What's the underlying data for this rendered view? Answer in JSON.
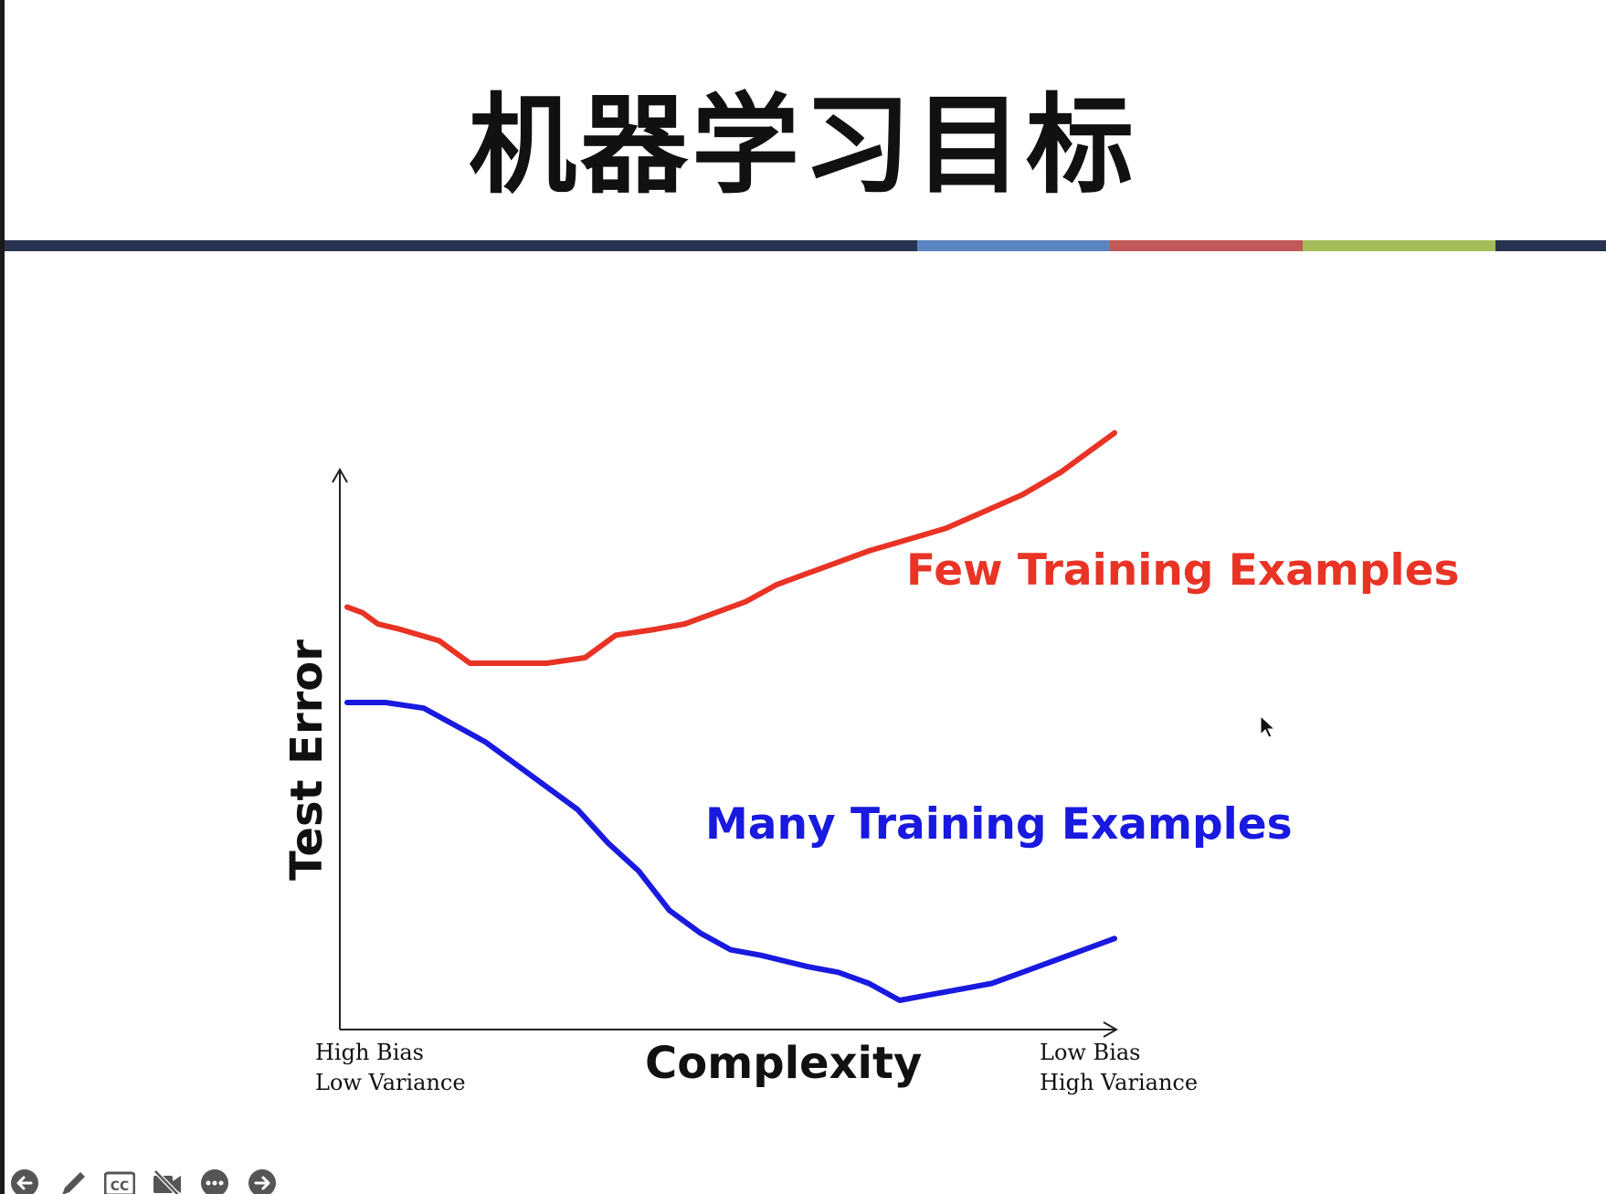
{
  "slide": {
    "title": "机器学习目标",
    "bar_colors": [
      "#28344f",
      "#5b85c0",
      "#bf5a58",
      "#a6be5a",
      "#28344f"
    ]
  },
  "chart_data": {
    "type": "line",
    "xlabel": "Complexity",
    "ylabel": "Test Error",
    "x_tick_labels": {
      "left": [
        "High Bias",
        "Low Variance"
      ],
      "right": [
        "Low Bias",
        "High Variance"
      ]
    },
    "xlim": [
      0,
      100
    ],
    "ylim": [
      0,
      100
    ],
    "series": [
      {
        "name": "Few Training Examples",
        "color": "#e83325",
        "x": [
          0,
          2,
          4,
          7,
          12,
          16,
          21,
          26,
          31,
          35,
          40,
          44,
          48,
          52,
          56,
          60,
          64,
          68,
          73,
          78,
          83,
          88,
          93,
          97,
          100
        ],
        "y": [
          70,
          69,
          67,
          66,
          64,
          60,
          60,
          60,
          61,
          65,
          66,
          67,
          69,
          71,
          74,
          76,
          78,
          80,
          82,
          84,
          87,
          90,
          94,
          98,
          101
        ]
      },
      {
        "name": "Many Training Examples",
        "color": "#1919e0",
        "x": [
          0,
          5,
          10,
          14,
          18,
          22,
          26,
          30,
          34,
          38,
          42,
          46,
          50,
          54,
          57,
          60,
          64,
          68,
          72,
          76,
          80,
          84,
          88,
          92,
          96,
          100
        ],
        "y": [
          53,
          53,
          52,
          49,
          46,
          42,
          38,
          34,
          28,
          23,
          16,
          12,
          9,
          8,
          7,
          6,
          5,
          3,
          0,
          1,
          2,
          3,
          5,
          7,
          9,
          11
        ]
      }
    ]
  },
  "toolbar": {
    "cc_label": "CC",
    "icons": [
      "back-arrow-icon",
      "pen-icon",
      "captions-icon",
      "video-off-icon",
      "more-icon",
      "forward-arrow-icon"
    ]
  }
}
